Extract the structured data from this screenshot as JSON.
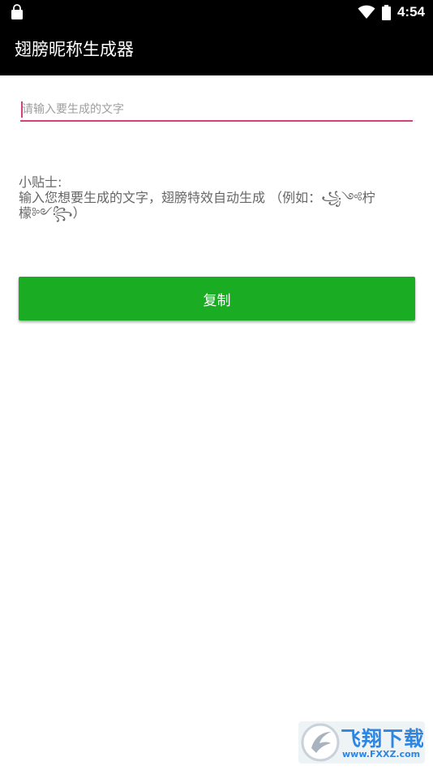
{
  "status_bar": {
    "time": "4:54",
    "icons": [
      "shopping-bag-icon",
      "wifi-icon",
      "battery-icon"
    ]
  },
  "app_bar": {
    "title": "翅膀昵称生成器",
    "background": "#000000"
  },
  "input": {
    "value": "",
    "placeholder": "请输入要生成的文字",
    "accent_color": "#d4417a"
  },
  "tips": {
    "heading": "小贴士:",
    "body": "输入您想要生成的文字，翅膀特效自动生成 （例如：꧁༺柠檬༻꧂）"
  },
  "copy_button": {
    "label": "复制",
    "color": "#1aad24"
  },
  "watermark": {
    "brand": "飞翔下载",
    "url": "www.FXXZ.com"
  }
}
